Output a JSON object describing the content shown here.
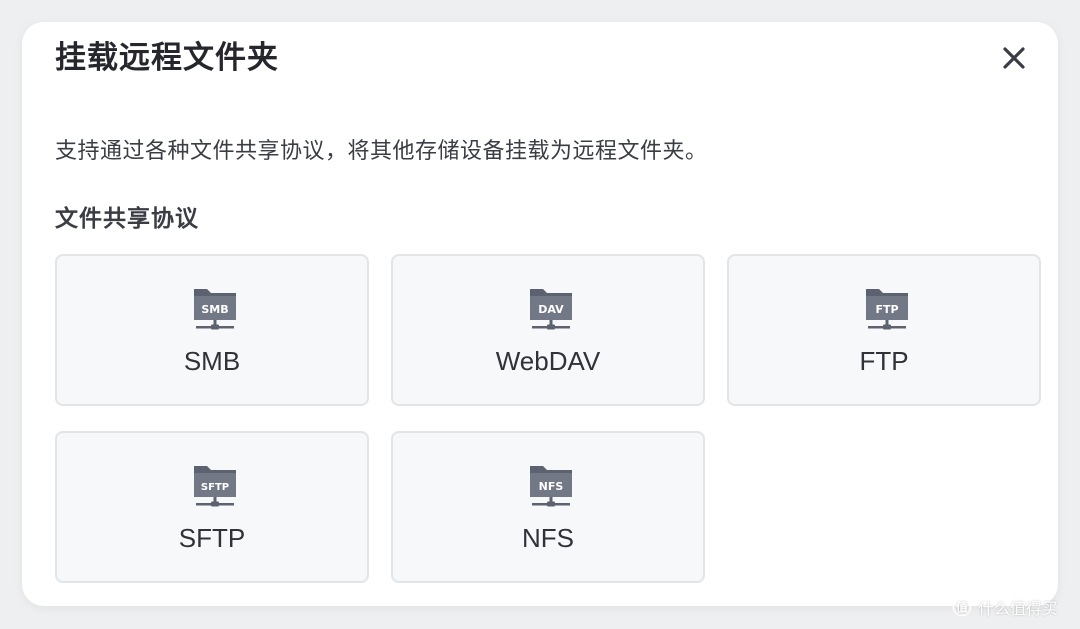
{
  "dialog": {
    "title": "挂载远程文件夹",
    "description": "支持通过各种文件共享协议，将其他存储设备挂载为远程文件夹。",
    "section_title": "文件共享协议",
    "close_icon": "close-icon",
    "protocols": [
      {
        "label": "SMB",
        "icon_text": "SMB",
        "icon": "network-folder-icon"
      },
      {
        "label": "WebDAV",
        "icon_text": "DAV",
        "icon": "network-folder-icon"
      },
      {
        "label": "FTP",
        "icon_text": "FTP",
        "icon": "network-folder-icon"
      },
      {
        "label": "SFTP",
        "icon_text": "SFTP",
        "icon": "network-folder-icon"
      },
      {
        "label": "NFS",
        "icon_text": "NFS",
        "icon": "network-folder-icon"
      }
    ]
  },
  "watermark": {
    "text": "什么值得买"
  },
  "colors": {
    "background": "#eeeff1",
    "dialog": "#ffffff",
    "card": "#f7f8fa",
    "card_border": "#e2e4e8",
    "icon": "#5d6270"
  }
}
